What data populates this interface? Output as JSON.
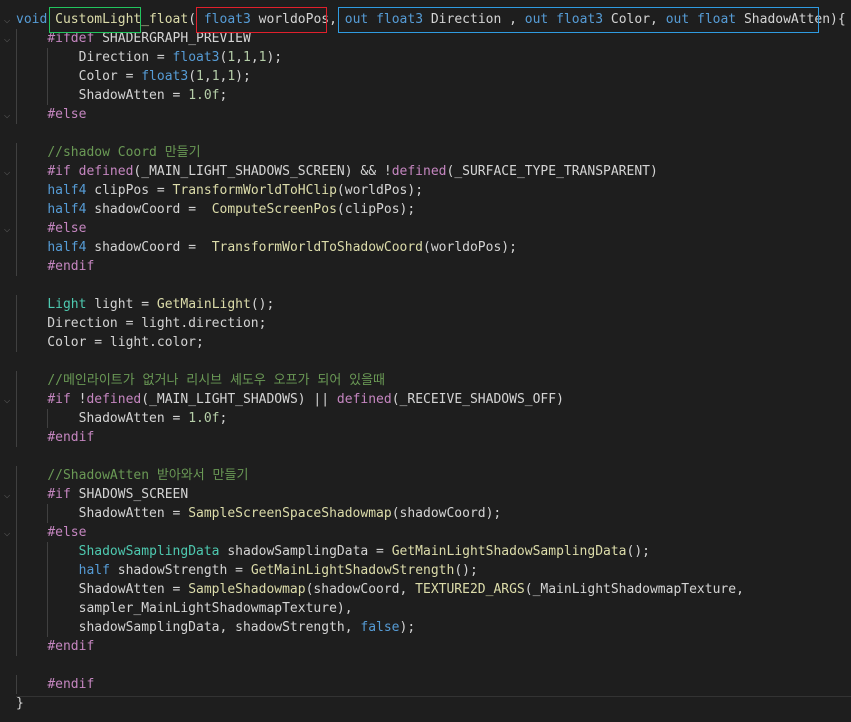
{
  "lines": [
    "void CustomLight_float( float3 worldoPos, out float3 Direction , out float3 Color, out float ShadowAtten){",
    "    #ifdef SHADERGRAPH_PREVIEW",
    "        Direction = float3(1,1,1);",
    "        Color = float3(1,1,1);",
    "        ShadowAtten = 1.0f;",
    "    #else",
    "",
    "    //shadow Coord 만들기",
    "    #if defined(_MAIN_LIGHT_SHADOWS_SCREEN) && !defined(_SURFACE_TYPE_TRANSPARENT)",
    "    half4 clipPos = TransformWorldToHClip(worldPos);",
    "    half4 shadowCoord =  ComputeScreenPos(clipPos);",
    "    #else",
    "    half4 shadowCoord =  TransformWorldToShadowCoord(worldoPos);",
    "    #endif",
    "",
    "    Light light = GetMainLight();",
    "    Direction = light.direction;",
    "    Color = light.color;",
    "",
    "    //메인라이트가 없거나 리시브 셰도우 오프가 되어 있을때",
    "    #if !defined(_MAIN_LIGHT_SHADOWS) || defined(_RECEIVE_SHADOWS_OFF)",
    "        ShadowAtten = 1.0f;",
    "    #endif",
    "",
    "    //ShadowAtten 받아와서 만들기",
    "    #if SHADOWS_SCREEN",
    "        ShadowAtten = SampleScreenSpaceShadowmap(shadowCoord);",
    "    #else",
    "        ShadowSamplingData shadowSamplingData = GetMainLightShadowSamplingData();",
    "        half shadowStrength = GetMainLightShadowStrength();",
    "        ShadowAtten = SampleShadowmap(shadowCoord, TEXTURE2D_ARGS(_MainLightShadowmapTexture,",
    "        sampler_MainLightShadowmapTexture),",
    "        shadowSamplingData, shadowStrength, false);",
    "    #endif",
    "",
    "    #endif",
    "}"
  ],
  "highlights": {
    "green": "#22c45e",
    "red": "#e0202c",
    "blue": "#2f9be0"
  },
  "theme": {
    "background": "#1e1e1e",
    "keyword": "#569cd6",
    "control": "#c586c0",
    "function": "#dcdcaa",
    "type": "#4ec9b0",
    "comment": "#6a9955",
    "number": "#b5cea8"
  }
}
